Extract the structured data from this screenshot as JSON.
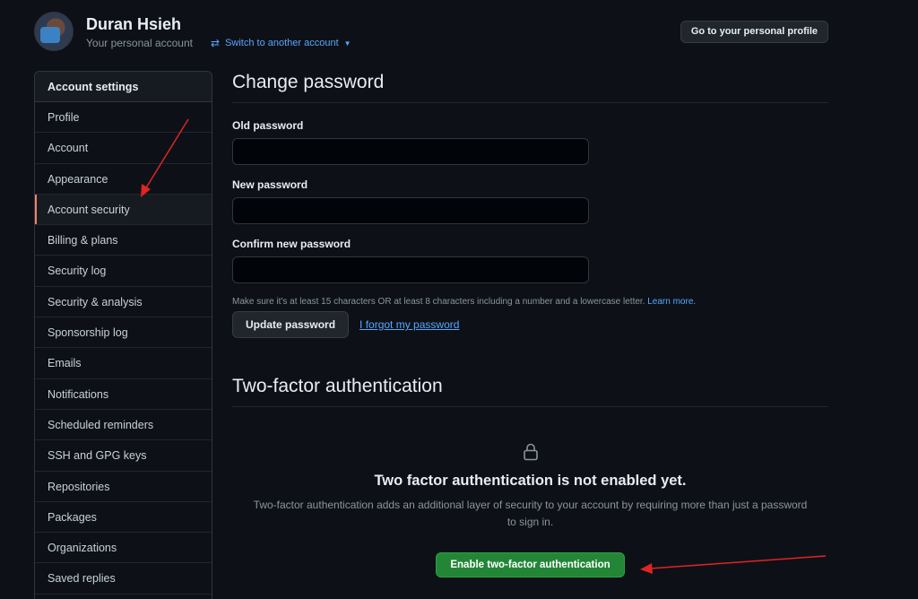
{
  "header": {
    "user_name": "Duran Hsieh",
    "user_subtitle": "Your personal account",
    "switch_account_label": "Switch to another account",
    "profile_button_label": "Go to your personal profile"
  },
  "sidebar": {
    "heading": "Account settings",
    "items": [
      {
        "label": "Profile"
      },
      {
        "label": "Account"
      },
      {
        "label": "Appearance"
      },
      {
        "label": "Account security",
        "active": true
      },
      {
        "label": "Billing & plans"
      },
      {
        "label": "Security log"
      },
      {
        "label": "Security & analysis"
      },
      {
        "label": "Sponsorship log"
      },
      {
        "label": "Emails"
      },
      {
        "label": "Notifications"
      },
      {
        "label": "Scheduled reminders"
      },
      {
        "label": "SSH and GPG keys"
      },
      {
        "label": "Repositories"
      },
      {
        "label": "Packages"
      },
      {
        "label": "Organizations"
      },
      {
        "label": "Saved replies"
      }
    ]
  },
  "change_password": {
    "title": "Change password",
    "old_label": "Old password",
    "old_value": "",
    "new_label": "New password",
    "new_value": "",
    "confirm_label": "Confirm new password",
    "confirm_value": "",
    "hint": "Make sure it's at least 15 characters OR at least 8 characters including a number and a lowercase letter.",
    "learn_more": "Learn more.",
    "update_button": "Update password",
    "forgot_link": "I forgot my password"
  },
  "two_factor": {
    "title": "Two-factor authentication",
    "heading": "Two factor authentication is not enabled yet.",
    "description": "Two-factor authentication adds an additional layer of security to your account by requiring more than just a password to sign in.",
    "enable_button": "Enable two-factor authentication"
  },
  "icons": {
    "switch": "arrows-swap-icon",
    "lock": "lock-icon",
    "caret": "caret-down-icon"
  },
  "colors": {
    "background": "#0d1117",
    "link": "#58a6ff",
    "active_indicator": "#f78166",
    "primary_button": "#238636",
    "annotation_arrow": "#e02424"
  }
}
